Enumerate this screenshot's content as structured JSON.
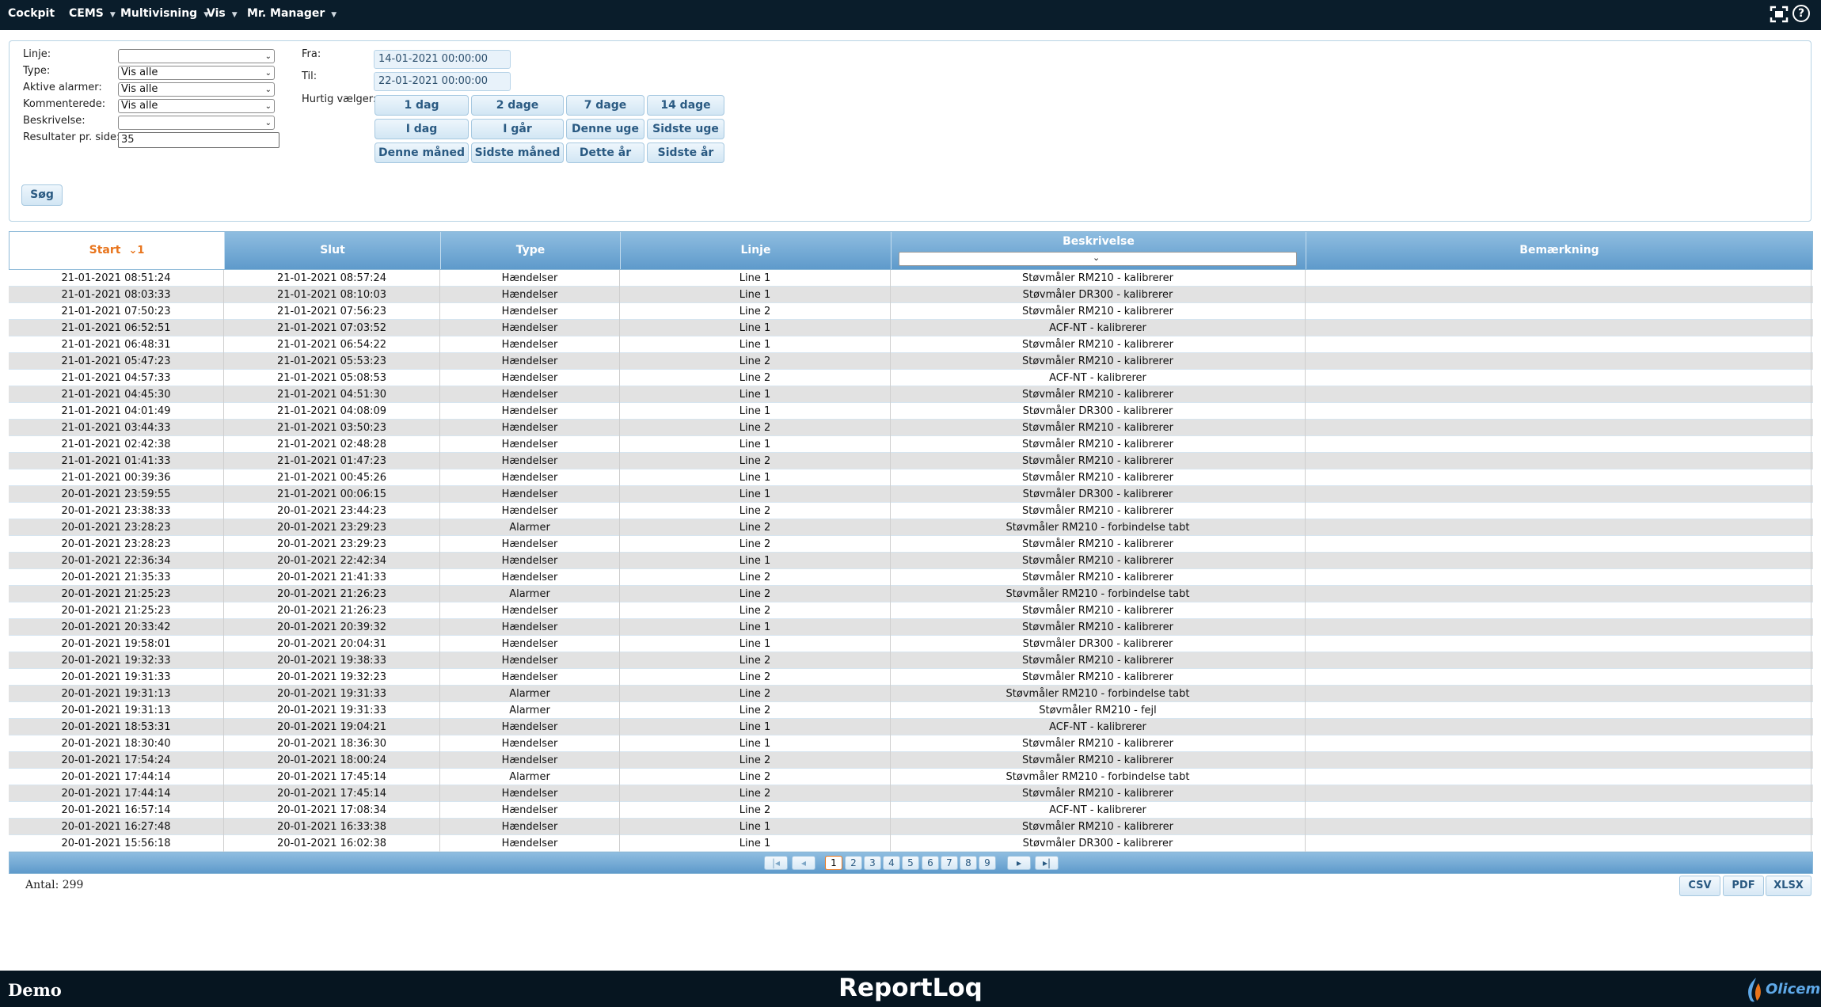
{
  "nav": {
    "brand": "Cockpit",
    "menus": [
      "CEMS",
      "Multivisning",
      "Vis",
      "Mr. Manager"
    ],
    "help": "?"
  },
  "filters": {
    "labels": {
      "line": "Linje:",
      "type": "Type:",
      "active_alarms": "Aktive alarmer:",
      "commented": "Kommenterede:",
      "description": "Beskrivelse:",
      "results_per_page": "Resultater pr. side:",
      "from": "Fra:",
      "to": "Til:",
      "quick": "Hurtig vælger:"
    },
    "values": {
      "line": "",
      "type": "Vis alle",
      "active_alarms": "Vis alle",
      "commented": "Vis alle",
      "description": "",
      "results_per_page": "35",
      "from": "14-01-2021 00:00:00",
      "to": "22-01-2021 00:00:00"
    },
    "quick_buttons": [
      [
        "1 dag",
        "2 dage",
        "7 dage",
        "14 dage"
      ],
      [
        "I dag",
        "I går",
        "Denne uge",
        "Sidste uge"
      ],
      [
        "Denne måned",
        "Sidste måned",
        "Dette år",
        "Sidste år"
      ]
    ],
    "search_label": "Søg"
  },
  "grid": {
    "columns": [
      "Start",
      "Slut",
      "Type",
      "Linje",
      "Beskrivelse",
      "Bemærkning"
    ],
    "sort_indicator": "1",
    "rows": [
      [
        "21-01-2021 08:51:24",
        "21-01-2021 08:57:24",
        "Hændelser",
        "Line 1",
        "Støvmåler RM210 - kalibrerer",
        ""
      ],
      [
        "21-01-2021 08:03:33",
        "21-01-2021 08:10:03",
        "Hændelser",
        "Line 1",
        "Støvmåler DR300 - kalibrerer",
        ""
      ],
      [
        "21-01-2021 07:50:23",
        "21-01-2021 07:56:23",
        "Hændelser",
        "Line 2",
        "Støvmåler RM210 - kalibrerer",
        ""
      ],
      [
        "21-01-2021 06:52:51",
        "21-01-2021 07:03:52",
        "Hændelser",
        "Line 1",
        "ACF-NT - kalibrerer",
        ""
      ],
      [
        "21-01-2021 06:48:31",
        "21-01-2021 06:54:22",
        "Hændelser",
        "Line 1",
        "Støvmåler RM210 - kalibrerer",
        ""
      ],
      [
        "21-01-2021 05:47:23",
        "21-01-2021 05:53:23",
        "Hændelser",
        "Line 2",
        "Støvmåler RM210 - kalibrerer",
        ""
      ],
      [
        "21-01-2021 04:57:33",
        "21-01-2021 05:08:53",
        "Hændelser",
        "Line 2",
        "ACF-NT - kalibrerer",
        ""
      ],
      [
        "21-01-2021 04:45:30",
        "21-01-2021 04:51:30",
        "Hændelser",
        "Line 1",
        "Støvmåler RM210 - kalibrerer",
        ""
      ],
      [
        "21-01-2021 04:01:49",
        "21-01-2021 04:08:09",
        "Hændelser",
        "Line 1",
        "Støvmåler DR300 - kalibrerer",
        ""
      ],
      [
        "21-01-2021 03:44:33",
        "21-01-2021 03:50:23",
        "Hændelser",
        "Line 2",
        "Støvmåler RM210 - kalibrerer",
        ""
      ],
      [
        "21-01-2021 02:42:38",
        "21-01-2021 02:48:28",
        "Hændelser",
        "Line 1",
        "Støvmåler RM210 - kalibrerer",
        ""
      ],
      [
        "21-01-2021 01:41:33",
        "21-01-2021 01:47:23",
        "Hændelser",
        "Line 2",
        "Støvmåler RM210 - kalibrerer",
        ""
      ],
      [
        "21-01-2021 00:39:36",
        "21-01-2021 00:45:26",
        "Hændelser",
        "Line 1",
        "Støvmåler RM210 - kalibrerer",
        ""
      ],
      [
        "20-01-2021 23:59:55",
        "21-01-2021 00:06:15",
        "Hændelser",
        "Line 1",
        "Støvmåler DR300 - kalibrerer",
        ""
      ],
      [
        "20-01-2021 23:38:33",
        "20-01-2021 23:44:23",
        "Hændelser",
        "Line 2",
        "Støvmåler RM210 - kalibrerer",
        ""
      ],
      [
        "20-01-2021 23:28:23",
        "20-01-2021 23:29:23",
        "Alarmer",
        "Line 2",
        "Støvmåler RM210 - forbindelse tabt",
        ""
      ],
      [
        "20-01-2021 23:28:23",
        "20-01-2021 23:29:23",
        "Hændelser",
        "Line 2",
        "Støvmåler RM210 - kalibrerer",
        ""
      ],
      [
        "20-01-2021 22:36:34",
        "20-01-2021 22:42:34",
        "Hændelser",
        "Line 1",
        "Støvmåler RM210 - kalibrerer",
        ""
      ],
      [
        "20-01-2021 21:35:33",
        "20-01-2021 21:41:33",
        "Hændelser",
        "Line 2",
        "Støvmåler RM210 - kalibrerer",
        ""
      ],
      [
        "20-01-2021 21:25:23",
        "20-01-2021 21:26:23",
        "Alarmer",
        "Line 2",
        "Støvmåler RM210 - forbindelse tabt",
        ""
      ],
      [
        "20-01-2021 21:25:23",
        "20-01-2021 21:26:23",
        "Hændelser",
        "Line 2",
        "Støvmåler RM210 - kalibrerer",
        ""
      ],
      [
        "20-01-2021 20:33:42",
        "20-01-2021 20:39:32",
        "Hændelser",
        "Line 1",
        "Støvmåler RM210 - kalibrerer",
        ""
      ],
      [
        "20-01-2021 19:58:01",
        "20-01-2021 20:04:31",
        "Hændelser",
        "Line 1",
        "Støvmåler DR300 - kalibrerer",
        ""
      ],
      [
        "20-01-2021 19:32:33",
        "20-01-2021 19:38:33",
        "Hændelser",
        "Line 2",
        "Støvmåler RM210 - kalibrerer",
        ""
      ],
      [
        "20-01-2021 19:31:33",
        "20-01-2021 19:32:23",
        "Hændelser",
        "Line 2",
        "Støvmåler RM210 - kalibrerer",
        ""
      ],
      [
        "20-01-2021 19:31:13",
        "20-01-2021 19:31:33",
        "Alarmer",
        "Line 2",
        "Støvmåler RM210 - forbindelse tabt",
        ""
      ],
      [
        "20-01-2021 19:31:13",
        "20-01-2021 19:31:33",
        "Alarmer",
        "Line 2",
        "Støvmåler RM210 - fejl",
        ""
      ],
      [
        "20-01-2021 18:53:31",
        "20-01-2021 19:04:21",
        "Hændelser",
        "Line 1",
        "ACF-NT - kalibrerer",
        ""
      ],
      [
        "20-01-2021 18:30:40",
        "20-01-2021 18:36:30",
        "Hændelser",
        "Line 1",
        "Støvmåler RM210 - kalibrerer",
        ""
      ],
      [
        "20-01-2021 17:54:24",
        "20-01-2021 18:00:24",
        "Hændelser",
        "Line 2",
        "Støvmåler RM210 - kalibrerer",
        ""
      ],
      [
        "20-01-2021 17:44:14",
        "20-01-2021 17:45:14",
        "Alarmer",
        "Line 2",
        "Støvmåler RM210 - forbindelse tabt",
        ""
      ],
      [
        "20-01-2021 17:44:14",
        "20-01-2021 17:45:14",
        "Hændelser",
        "Line 2",
        "Støvmåler RM210 - kalibrerer",
        ""
      ],
      [
        "20-01-2021 16:57:14",
        "20-01-2021 17:08:34",
        "Hændelser",
        "Line 2",
        "ACF-NT - kalibrerer",
        ""
      ],
      [
        "20-01-2021 16:27:48",
        "20-01-2021 16:33:38",
        "Hændelser",
        "Line 1",
        "Støvmåler RM210 - kalibrerer",
        ""
      ],
      [
        "20-01-2021 15:56:18",
        "20-01-2021 16:02:38",
        "Hændelser",
        "Line 1",
        "Støvmåler DR300 - kalibrerer",
        ""
      ]
    ]
  },
  "pager": {
    "first": "|◂",
    "prev": "◂",
    "pages": [
      "1",
      "2",
      "3",
      "4",
      "5",
      "6",
      "7",
      "8",
      "9"
    ],
    "active_page": "1",
    "next": "▸",
    "last": "▸|"
  },
  "count_label": "Antal: 299",
  "export": [
    "CSV",
    "PDF",
    "XLSX"
  ],
  "footer": {
    "left": "Demo",
    "center": "ReportLoq",
    "logo": "Olicem"
  },
  "colors": {
    "topbar": "#0a1d2b",
    "header_blue": "#5e9acb",
    "accent_orange": "#e8741c",
    "button_text": "#2a5a82"
  }
}
